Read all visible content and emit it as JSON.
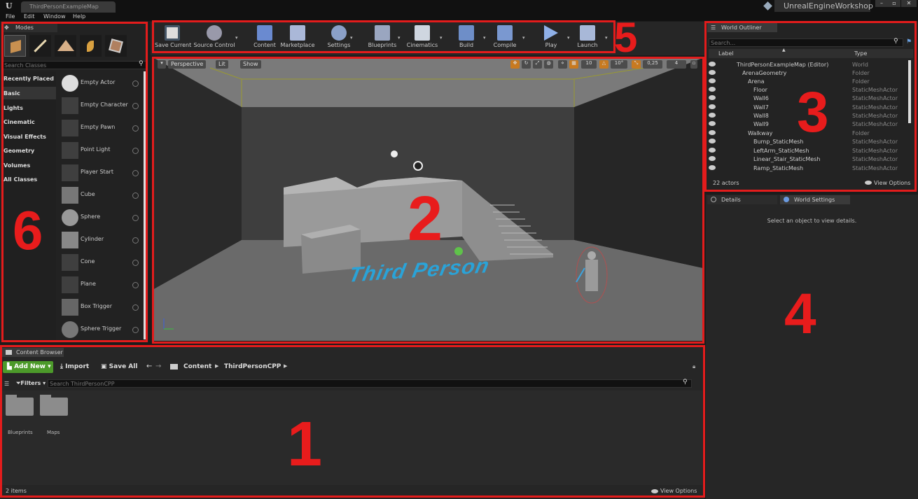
{
  "window": {
    "doc_tab": "ThirdPersonExampleMap",
    "app_name": "UnrealEngineWorkshop"
  },
  "menu": [
    "File",
    "Edit",
    "Window",
    "Help"
  ],
  "modes": {
    "tab": "Modes",
    "search_placeholder": "Search Classes",
    "categories": [
      "Recently Placed",
      "Basic",
      "Lights",
      "Cinematic",
      "Visual Effects",
      "Geometry",
      "Volumes",
      "All Classes"
    ],
    "items": [
      "Empty Actor",
      "Empty Character",
      "Empty Pawn",
      "Point Light",
      "Player Start",
      "Cube",
      "Sphere",
      "Cylinder",
      "Cone",
      "Plane",
      "Box Trigger",
      "Sphere Trigger"
    ]
  },
  "toolbar": {
    "buttons": [
      "Save Current",
      "Source Control",
      "Content",
      "Marketplace",
      "Settings",
      "Blueprints",
      "Cinematics",
      "Build",
      "Compile",
      "Play",
      "Launch"
    ]
  },
  "viewport": {
    "perspective": "Perspective",
    "lit": "Lit",
    "show": "Show",
    "grid_snap": "10",
    "rot_snap": "10°",
    "scale_snap": "0,25",
    "cam_speed": "4",
    "scene_text": "Third Person"
  },
  "outliner": {
    "tab": "World Outliner",
    "search_placeholder": "Search...",
    "col_label": "Label",
    "col_type": "Type",
    "rows": [
      {
        "label": "ThirdPersonExampleMap (Editor)",
        "type": "World"
      },
      {
        "label": "ArenaGeometry",
        "type": "Folder"
      },
      {
        "label": "Arena",
        "type": "Folder"
      },
      {
        "label": "Floor",
        "type": "StaticMeshActor"
      },
      {
        "label": "Wall6",
        "type": "StaticMeshActor"
      },
      {
        "label": "Wall7",
        "type": "StaticMeshActor"
      },
      {
        "label": "Wall8",
        "type": "StaticMeshActor"
      },
      {
        "label": "Wall9",
        "type": "StaticMeshActor"
      },
      {
        "label": "Walkway",
        "type": "Folder"
      },
      {
        "label": "Bump_StaticMesh",
        "type": "StaticMeshActor"
      },
      {
        "label": "LeftArm_StaticMesh",
        "type": "StaticMeshActor"
      },
      {
        "label": "Linear_Stair_StaticMesh",
        "type": "StaticMeshActor"
      },
      {
        "label": "Ramp_StaticMesh",
        "type": "StaticMeshActor"
      }
    ],
    "count": "22 actors",
    "view_options": "View Options"
  },
  "details": {
    "tab_details": "Details",
    "tab_world_settings": "World Settings",
    "empty_message": "Select an object to view details."
  },
  "content_browser": {
    "tab": "Content Browser",
    "add_new": "Add New",
    "import": "Import",
    "save_all": "Save All",
    "path": [
      "Content",
      "ThirdPersonCPP"
    ],
    "filters": "Filters",
    "search_placeholder": "Search ThirdPersonCPP",
    "folders": [
      "Blueprints",
      "Maps"
    ],
    "count": "2 items",
    "view_options": "View Options"
  },
  "annotations": [
    "1",
    "2",
    "3",
    "4",
    "5",
    "6"
  ],
  "colors": {
    "accent_red": "#e31c1c",
    "add_new_green": "#4c9a2a",
    "scene_text": "#2aa3d8"
  }
}
